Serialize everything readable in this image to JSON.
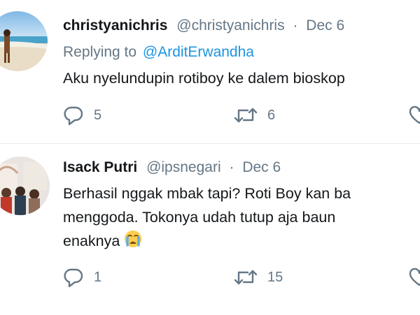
{
  "tweets": [
    {
      "display_name": "christyanichris",
      "handle": "@christyanichris",
      "separator": "·",
      "date": "Dec 6",
      "reply_prefix": "Replying to",
      "reply_to": "@ArditErwandha",
      "text_lines": [
        "Aku nyelundupin rotiboy ke dalem bioskop"
      ],
      "replies": "5",
      "retweets": "6"
    },
    {
      "display_name": "Isack Putri",
      "handle": "@ipsnegari",
      "separator": "·",
      "date": "Dec 6",
      "text_lines": [
        "Berhasil nggak mbak tapi? Roti Boy kan ba",
        "menggoda. Tokonya udah tutup aja baun",
        "enaknya"
      ],
      "emoji_icon": "crying-face-emoji",
      "replies": "1",
      "retweets": "15"
    }
  ],
  "icons": {
    "reply": "reply-bubble-icon",
    "retweet": "retweet-icon",
    "like": "heart-icon"
  },
  "colors": {
    "name": "#14171a",
    "secondary": "#657786",
    "link": "#1b95e0",
    "divider": "#e6ecf0"
  }
}
